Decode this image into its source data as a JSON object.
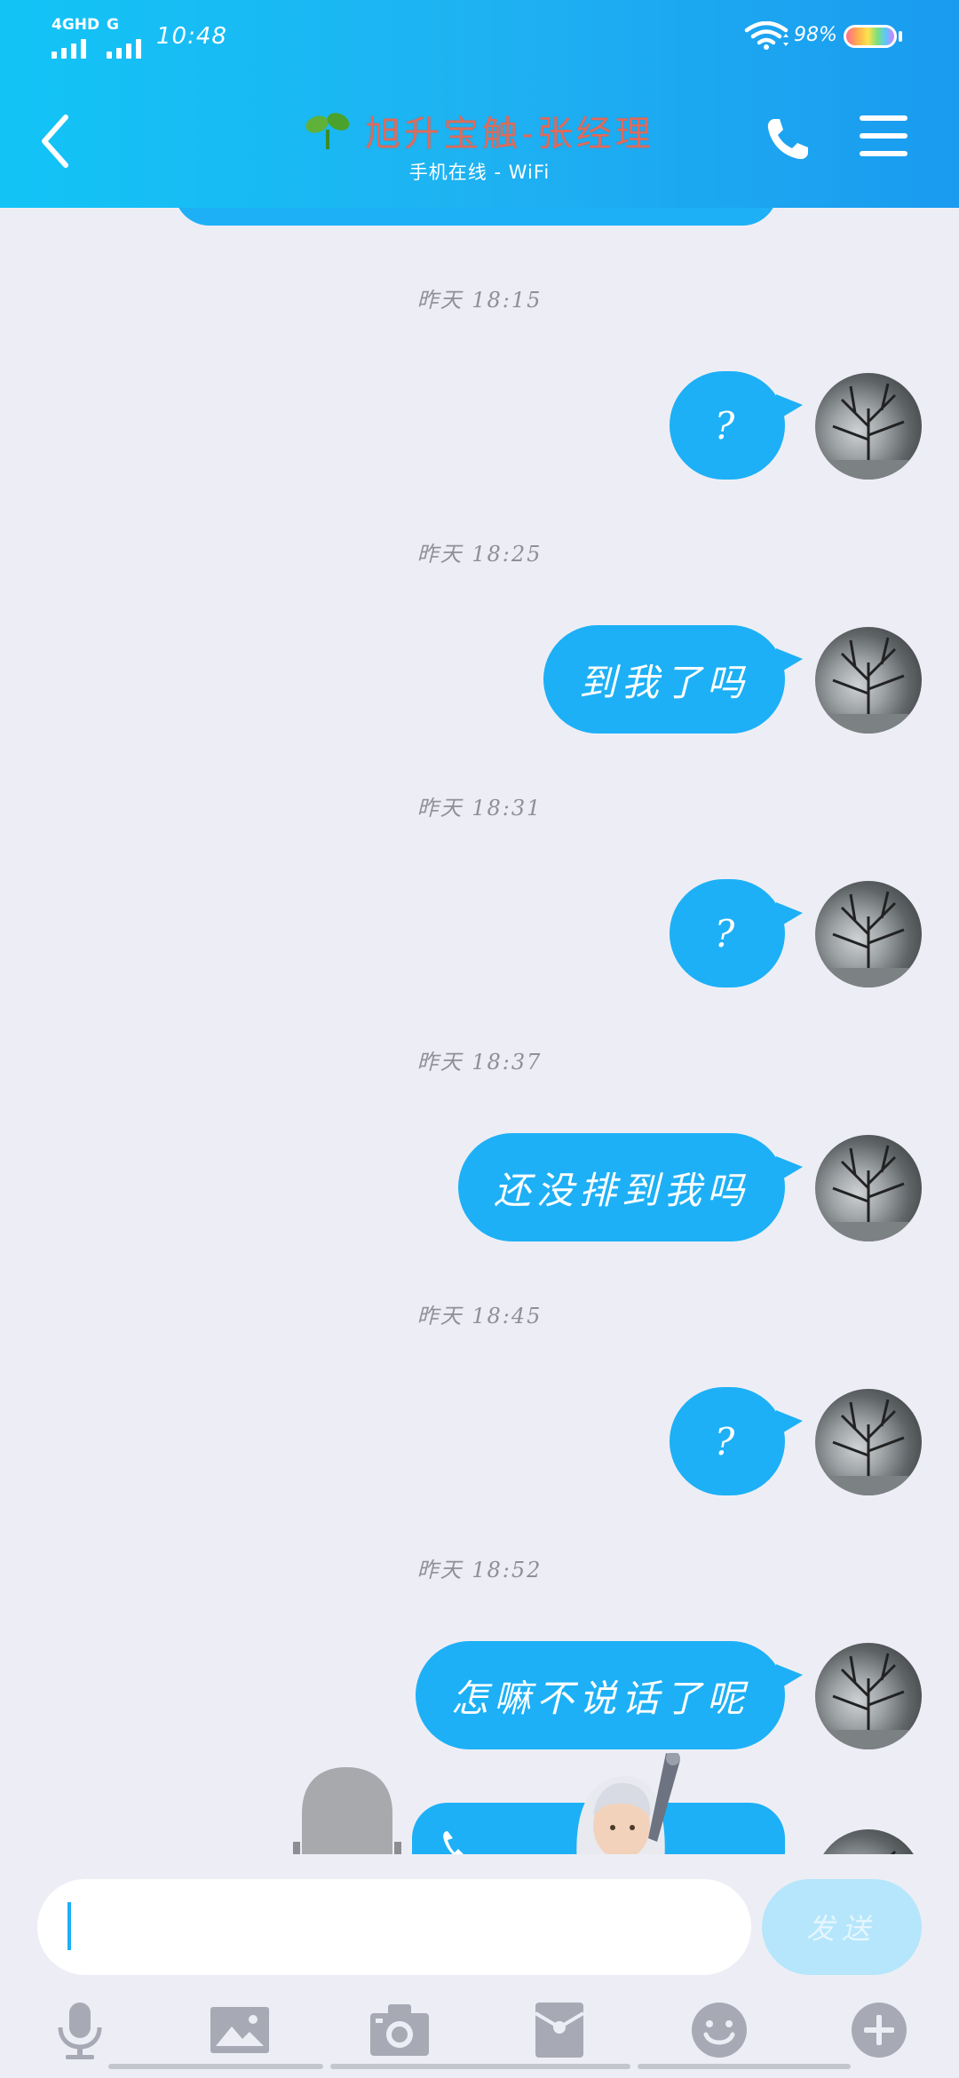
{
  "status_bar": {
    "network": "4GHD",
    "network2": "G",
    "time": "10:48",
    "battery": "98%"
  },
  "header": {
    "title": "旭升宝触-张经理",
    "subtitle": "手机在线 - WiFi",
    "title_icon": "sprout-icon",
    "back_icon": "chevron-left-icon",
    "call_icon": "phone-icon",
    "menu_icon": "menu-icon"
  },
  "messages": [
    {
      "time": "昨天 18:15",
      "text": "?"
    },
    {
      "time": "昨天 18:25",
      "text": "到我了吗"
    },
    {
      "time": "昨天 18:31",
      "text": "?"
    },
    {
      "time": "昨天 18:37",
      "text": "还没排到我吗"
    },
    {
      "time": "昨天 18:45",
      "text": "?"
    },
    {
      "time": "昨天 18:52",
      "text": "怎嘛不说话了呢"
    }
  ],
  "input": {
    "placeholder": "",
    "value": "",
    "send_label": "发送"
  },
  "toolbar": [
    {
      "icon": "microphone-icon"
    },
    {
      "icon": "image-icon"
    },
    {
      "icon": "camera-icon"
    },
    {
      "icon": "red-packet-icon"
    },
    {
      "icon": "emoji-icon"
    },
    {
      "icon": "plus-icon"
    }
  ],
  "colors": {
    "header_start": "#12c4f6",
    "header_end": "#1a9bf0",
    "bubble": "#1db0f6",
    "background": "#edeef5",
    "send_disabled": "#b6e6fb"
  }
}
